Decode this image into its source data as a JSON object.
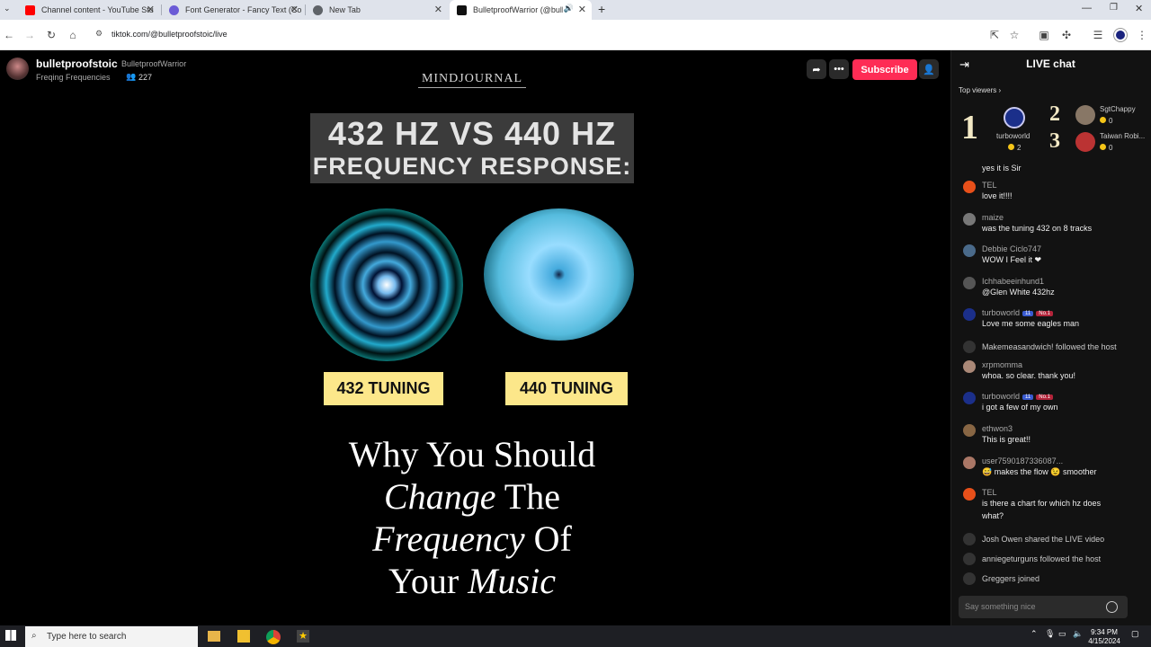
{
  "browser": {
    "tabs": [
      {
        "title": "Channel content - YouTube Stu",
        "favicon_color": "#ff0000"
      },
      {
        "title": "Font Generator - Fancy Text (Co",
        "favicon_color": "#6b5bd6"
      },
      {
        "title": "New Tab",
        "favicon_color": "#5f6368"
      },
      {
        "title": "BulletproofWarrior (@bullet",
        "favicon_color": "#111111",
        "active": true
      }
    ],
    "url": "tiktok.com/@bulletproofstoic/live"
  },
  "stream": {
    "streamer": "bulletproofstoic",
    "handle": "BulletproofWarrior",
    "subtitle": "Freqing Frequencies",
    "viewer_count": "227",
    "subscribe_label": "Subscribe",
    "video": {
      "brand": "MINDJOURNAL",
      "headline1": "432 HZ VS 440 HZ",
      "headline2": "FREQUENCY RESPONSE:",
      "tuning_left": "432 TUNING",
      "tuning_right": "440 TUNING",
      "why_1": "Why You Should",
      "why_2a": "Change",
      "why_2b": " The",
      "why_3a": "Frequency",
      "why_3b": " Of",
      "why_4a": "Your ",
      "why_4b": "Music"
    }
  },
  "chat": {
    "title": "LIVE chat",
    "top_viewers_label": "Top viewers",
    "top": [
      {
        "rank": "1",
        "name": "turboworld",
        "coins": "2"
      },
      {
        "rank": "2",
        "name": "SgtChappy",
        "coins": "0"
      },
      {
        "rank": "3",
        "name": "Taiwan Robi...",
        "coins": "0"
      }
    ],
    "messages": [
      {
        "user": "",
        "text": "yes it is Sir"
      },
      {
        "user": "TEL",
        "text": "love it!!!!"
      },
      {
        "user": "maize",
        "text": "was the tuning 432 on 8 tracks"
      },
      {
        "user": "Debbie Ciclo747",
        "text": "WOW I Feel it ❤"
      },
      {
        "user": "Ichhabeeinhund1",
        "text": "@Glen White 432hz"
      },
      {
        "user": "turboworld",
        "text": "Love me some eagles man",
        "badges": [
          "11",
          "No.1"
        ]
      },
      {
        "user": "",
        "text": "Makemeasandwich! followed the host"
      },
      {
        "user": "xrpmomma",
        "text": "whoa. so clear. thank you!"
      },
      {
        "user": "turboworld",
        "text": "i got a few of my own",
        "badges": [
          "11",
          "No.1"
        ]
      },
      {
        "user": "ethwon3",
        "text": "This is great!!"
      },
      {
        "user": "user7590187336087...",
        "text": "😅 makes the flow 😉 smoother"
      },
      {
        "user": "TEL",
        "text": "is there a chart for which hz does what?"
      },
      {
        "user": "",
        "text": "Josh Owen shared the LIVE video"
      },
      {
        "user": "",
        "text": "anniegeturguns followed the host"
      },
      {
        "user": "",
        "text": "Greggers joined"
      }
    ],
    "input_placeholder": "Say something nice"
  },
  "taskbar": {
    "search_placeholder": "Type here to search",
    "time": "9:34 PM",
    "date": "4/15/2024"
  }
}
